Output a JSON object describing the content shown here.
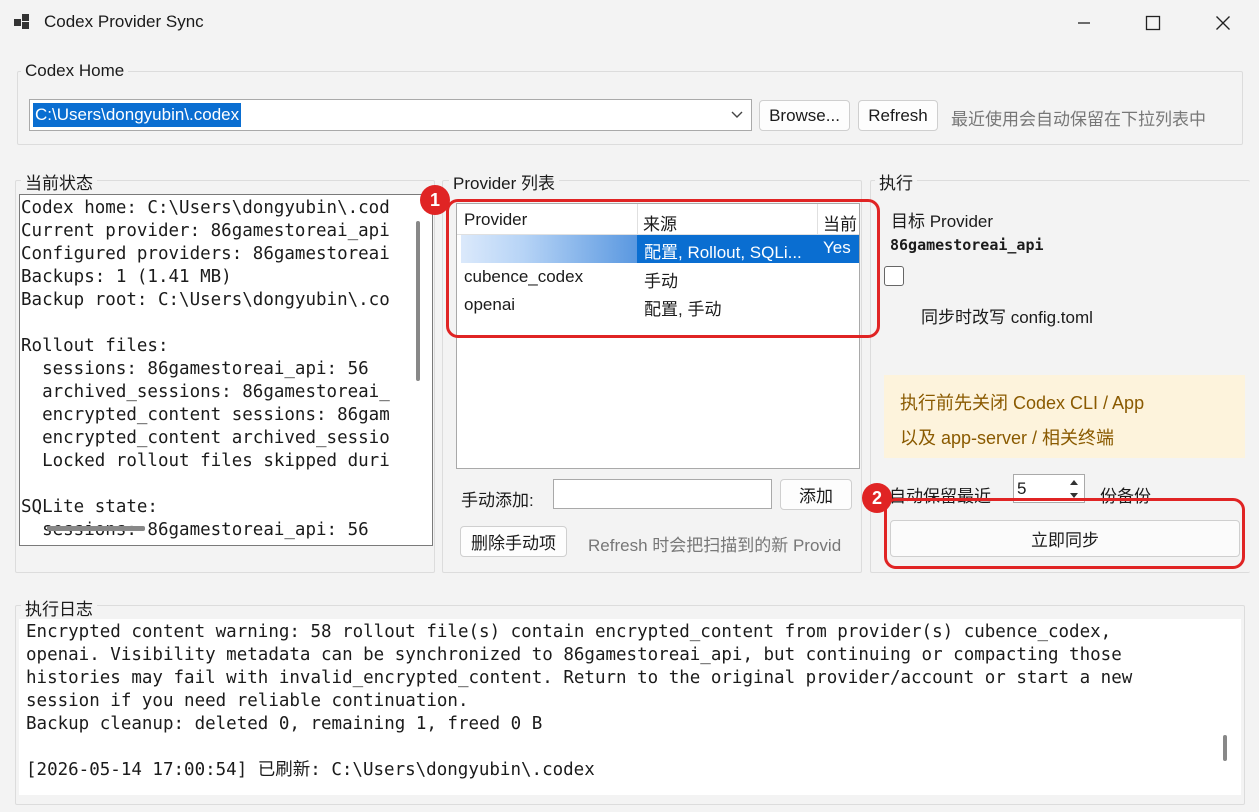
{
  "window": {
    "title": "Codex Provider Sync"
  },
  "home": {
    "group_label": "Codex Home",
    "path_value": "C:\\Users\\dongyubin\\.codex",
    "browse_label": "Browse...",
    "refresh_label": "Refresh",
    "hint": "最近使用会自动保留在下拉列表中"
  },
  "status": {
    "group_label": "当前状态",
    "lines": [
      "Codex home: C:\\Users\\dongyubin\\.cod",
      "Current provider: 86gamestoreai_api",
      "Configured providers: 86gamestoreai",
      "Backups: 1 (1.41 MB)",
      "Backup root: C:\\Users\\dongyubin\\.co",
      "",
      "Rollout files:",
      "  sessions: 86gamestoreai_api: 56",
      "  archived_sessions: 86gamestoreai_",
      "  encrypted_content sessions: 86gam",
      "  encrypted_content archived_sessio",
      "  Locked rollout files skipped duri",
      "",
      "SQLite state:",
      "  sessions: 86gamestoreai_api: 56"
    ]
  },
  "providers": {
    "group_label": "Provider 列表",
    "columns": [
      "Provider",
      "来源",
      "当前"
    ],
    "rows": [
      {
        "provider": "",
        "source": "配置, Rollout, SQLi...",
        "current": "Yes",
        "selected": true
      },
      {
        "provider": "cubence_codex",
        "source": "手动",
        "current": "",
        "selected": false
      },
      {
        "provider": "openai",
        "source": "配置, 手动",
        "current": "",
        "selected": false
      }
    ],
    "manual_add_label": "手动添加:",
    "manual_add_value": "",
    "add_button": "添加",
    "delete_button": "删除手动项",
    "refresh_hint": "Refresh 时会把扫描到的新 Provid"
  },
  "execute": {
    "group_label": "执行",
    "target_label": "目标 Provider",
    "target_value": "86gamestoreai_api",
    "rewrite_config_label": "同步时改写 config.toml",
    "rewrite_config_checked": false,
    "warning_line1": "执行前先关闭 Codex CLI / App",
    "warning_line2": "以及 app-server / 相关终端",
    "keep_prefix": "自动保留最近",
    "keep_value": "5",
    "keep_suffix": "份备份",
    "sync_button": "立即同步"
  },
  "log": {
    "group_label": "执行日志",
    "lines": [
      "Encrypted content warning: 58 rollout file(s) contain encrypted_content from provider(s) cubence_codex,",
      "openai. Visibility metadata can be synchronized to 86gamestoreai_api, but continuing or compacting those",
      "histories may fail with invalid_encrypted_content. Return to the original provider/account or start a new",
      "session if you need reliable continuation.",
      "Backup cleanup: deleted 0, remaining 1, freed 0 B",
      "",
      "[2026-05-14 17:00:54] 已刷新: C:\\Users\\dongyubin\\.codex"
    ]
  },
  "annotations": {
    "marker1": "1",
    "marker2": "2"
  },
  "colors": {
    "selection": "#0a6ed1",
    "annotation": "#e02424",
    "warning_bg": "#fdf3dc"
  }
}
